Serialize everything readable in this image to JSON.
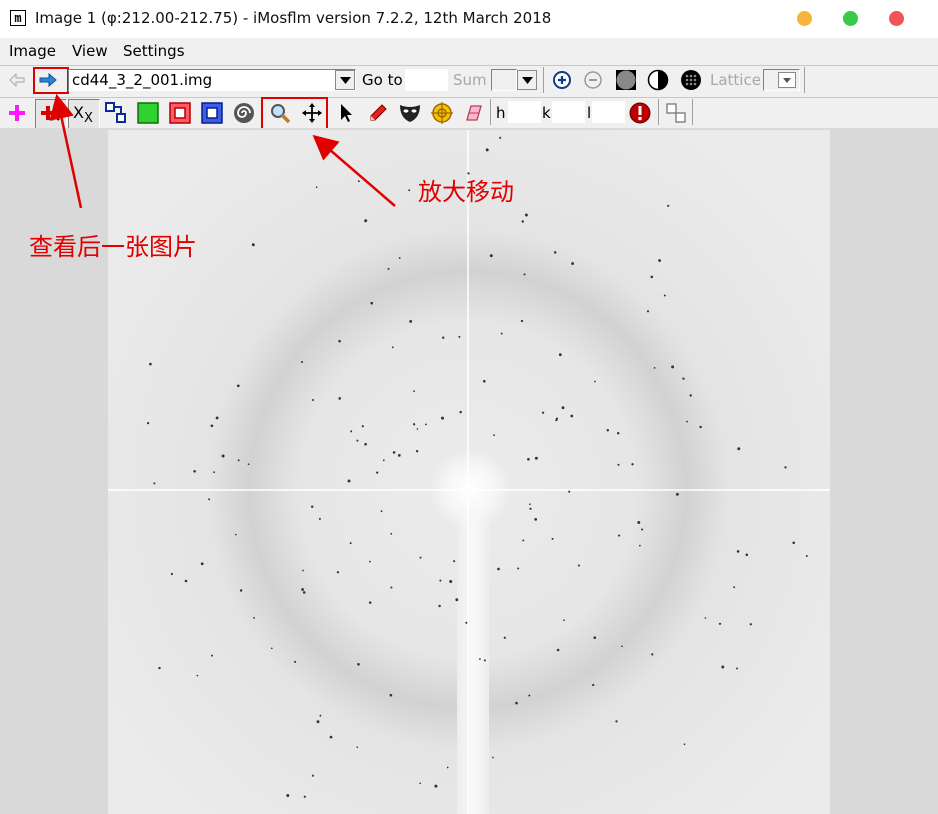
{
  "window": {
    "title": "Image 1 (φ:212.00-212.75) - iMosflm version 7.2.2, 12th March 2018",
    "app_icon": "m",
    "controls": {
      "minimize_color": "#f6b53a",
      "maximize_color": "#3cc84a",
      "close_color": "#f05454"
    }
  },
  "menubar": {
    "items": [
      "Image",
      "View",
      "Settings"
    ]
  },
  "toolbar1": {
    "image_file": "cd44_3_2_001.img",
    "goto_label": "Go to",
    "goto_value": "",
    "sum_label": "Sum",
    "lattice_label": "Lattice"
  },
  "toolbar2": {
    "h_label": "h",
    "k_label": "k",
    "l_label": "l",
    "h_value": "",
    "k_value": "",
    "l_value": ""
  },
  "annotations": {
    "next_image": "查看后一张图片",
    "zoom_pan": "放大移动",
    "color": "#e00000"
  },
  "icons": [
    "back-arrow-icon",
    "forward-arrow-icon",
    "dropdown-arrow-icon",
    "zoom-in-icon",
    "zoom-out-icon",
    "circle-mask-icon",
    "contrast-icon",
    "lattice-dots-icon",
    "add-spot-icon",
    "delete-spot-icon",
    "xx-icon",
    "blocks-icon",
    "green-square-icon",
    "red-box-icon",
    "blue-box-icon",
    "spiral-icon",
    "magnifier-icon",
    "move-icon",
    "pointer-icon",
    "pencil-icon",
    "mask-icon",
    "target-icon",
    "eraser-icon",
    "alert-icon",
    "panels-icon"
  ]
}
